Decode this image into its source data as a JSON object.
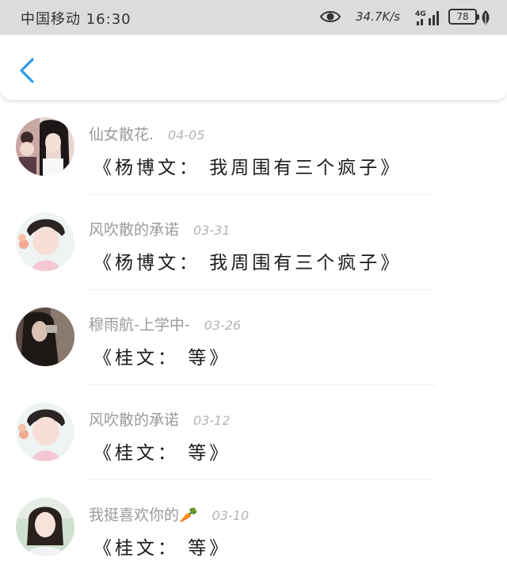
{
  "status_bar": {
    "carrier_time": "中国移动 16:30",
    "speed": "34.7K/s",
    "battery": "78",
    "icons": [
      "eye-icon",
      "signal-4g-icon",
      "battery-icon",
      "leaf-icon"
    ]
  },
  "nav": {
    "back_icon": "chevron-left-icon",
    "accent_color": "#2d9bef"
  },
  "comments": [
    {
      "user": "仙女散花.",
      "date": "04-05",
      "text": "《杨博文： 我周围有三个疯子》"
    },
    {
      "user": "风吹散的承诺",
      "date": "03-31",
      "text": "《杨博文： 我周围有三个疯子》"
    },
    {
      "user": "穆雨航-上学中-",
      "date": "03-26",
      "text": "《桂文： 等》"
    },
    {
      "user": "风吹散的承诺",
      "date": "03-12",
      "text": "《桂文： 等》"
    },
    {
      "user": "我挺喜欢你的🥕",
      "date": "03-10",
      "text": "《桂文： 等》"
    }
  ]
}
